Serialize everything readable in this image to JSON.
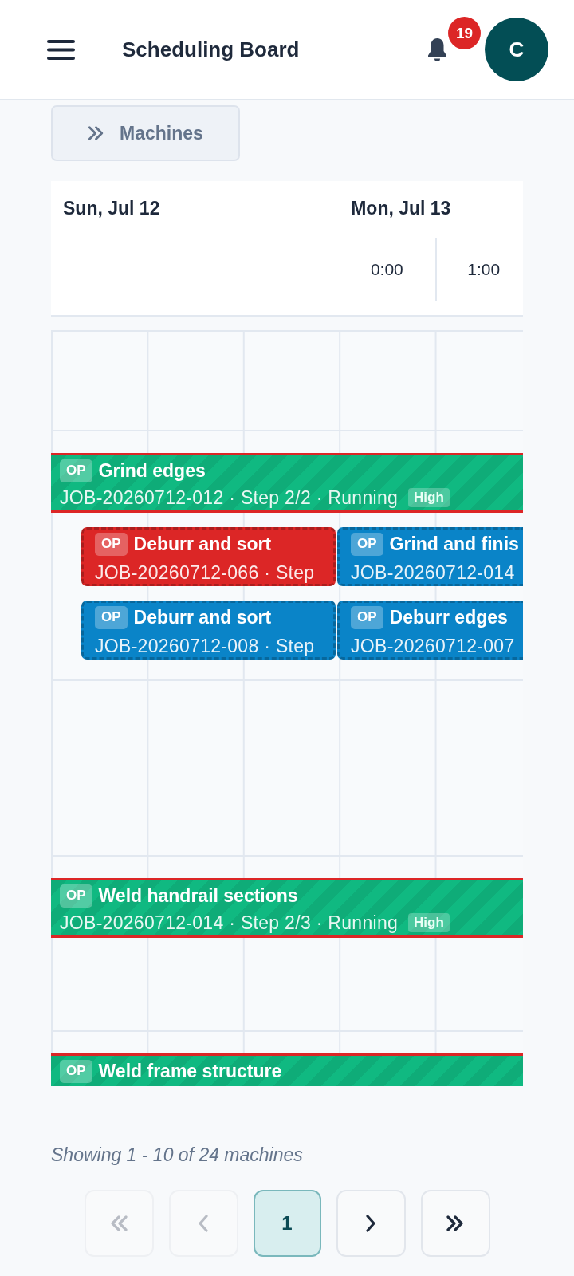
{
  "header": {
    "title": "Scheduling Board",
    "notifications": "19",
    "avatar": "C"
  },
  "machines_button": {
    "label": "Machines"
  },
  "timeline": {
    "days": [
      {
        "label": "Sun, Jul 12"
      },
      {
        "label": "Mon, Jul 13",
        "hours": [
          "0:00",
          "1:00"
        ]
      }
    ]
  },
  "rows": [
    {
      "kind": "empty"
    },
    {
      "kind": "machine",
      "operation": {
        "badge": "OP",
        "title": "Grind edges",
        "details": "JOB-20260712-012 · Step 2/2 · Running",
        "priority": "High",
        "color": "#10b981",
        "alert": true
      },
      "queued": [
        {
          "badge": "OP",
          "title": "Deburr and sort",
          "details": "JOB-20260712-066 · Step",
          "color": "#dc2626"
        },
        {
          "badge": "OP",
          "title": "Grind and finis",
          "details": "JOB-20260712-014",
          "color": "#0a84c8"
        },
        {
          "badge": "OP",
          "title": "Deburr and sort",
          "details": "JOB-20260712-008 · Step",
          "color": "#0a84c8"
        },
        {
          "badge": "OP",
          "title": "Deburr edges",
          "details": "JOB-20260712-007",
          "color": "#0a84c8"
        }
      ]
    },
    {
      "kind": "empty"
    },
    {
      "kind": "machine",
      "operation": {
        "badge": "OP",
        "title": "Weld handrail sections",
        "details": "JOB-20260712-014 · Step 2/3 · Running",
        "priority": "High",
        "color": "#10b981",
        "alert": true
      }
    },
    {
      "kind": "machine",
      "operation": {
        "badge": "OP",
        "title": "Weld frame structure",
        "color": "#10b981",
        "alert": true
      }
    }
  ],
  "pagination": {
    "summary": "Showing 1 - 10 of 24 machines",
    "buttons": [
      {
        "kind": "first",
        "disabled": true
      },
      {
        "kind": "prev",
        "disabled": true
      },
      {
        "kind": "page",
        "label": "1",
        "selected": true
      },
      {
        "kind": "next",
        "disabled": false
      },
      {
        "kind": "last",
        "disabled": false
      }
    ]
  }
}
